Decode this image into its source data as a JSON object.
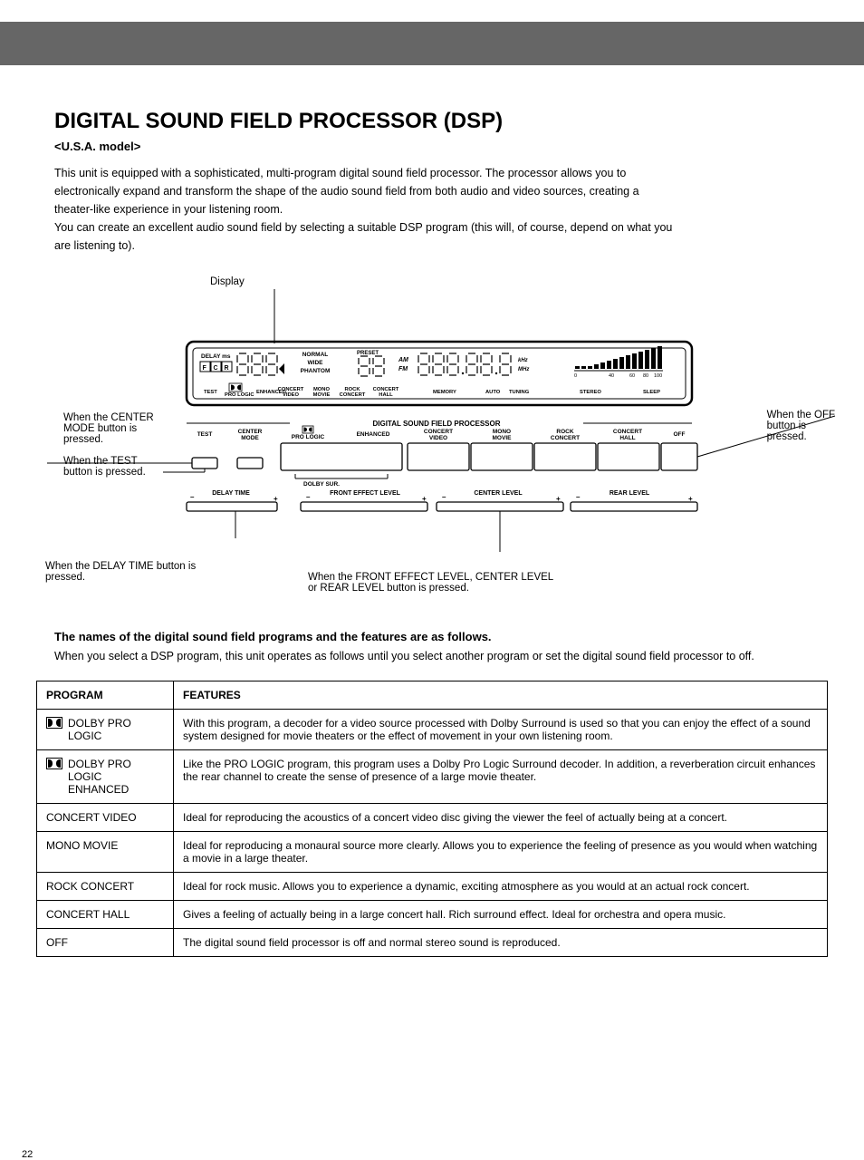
{
  "title": "DIGITAL SOUND FIELD PROCESSOR (DSP)",
  "subtitle": "<U.S.A. model>",
  "intro": [
    "This unit is equipped with a sophisticated, multi-program digital sound field processor. The processor allows you to",
    "electronically expand and transform the shape of the audio sound field from both audio and video sources, creating a",
    "theater-like experience in your listening room.",
    "You can create an excellent audio sound field by selecting a suitable DSP program (this will, of course, depend on what you",
    "are listening to)."
  ],
  "displayLabel": "Display",
  "callouts": {
    "testBtn": "When the TEST\nbutton is pressed.",
    "centerBtn": "When the CENTER\nMODE button is\npressed.",
    "offBtn": "When the OFF\nbutton is\npressed.",
    "delayBtn": "When the DELAY TIME button is\npressed.",
    "levelBtns": "When the FRONT EFFECT LEVEL, CENTER LEVEL\nor REAR LEVEL button is pressed."
  },
  "lcd": {
    "delayMs": "DELAY ms",
    "fcr": [
      "F",
      "C",
      "R"
    ],
    "centerModes": [
      "NORMAL",
      "WIDE",
      "PHANTOM"
    ],
    "row2": [
      "TEST",
      "PRO LOGIC",
      "ENHANCED",
      "CONCERT\nVIDEO",
      "MONO\nMOVIE",
      "ROCK\nCONCERT",
      "CONCERT\nHALL",
      "MEMORY",
      "AUTO",
      "TUNING",
      "STEREO",
      "SLEEP"
    ],
    "preset": "PRESET",
    "am": "AM",
    "fm": "FM",
    "khz": "kHz",
    "mhz": "MHz",
    "vuScale": [
      "0",
      "40",
      "60",
      "80",
      "100"
    ]
  },
  "buttonsHeader": "DIGITAL SOUND FIELD PROCESSOR",
  "btnRow1": [
    "TEST",
    "CENTER\nMODE",
    "PRO LOGIC\nENHANCED",
    "CONCERT\nVIDEO",
    "MONO\nMOVIE",
    "ROCK\nCONCERT",
    "CONCERT\nHALL",
    "OFF"
  ],
  "dolbySur": "DOLBY SUR.",
  "sliders": [
    "DELAY TIME",
    "FRONT EFFECT LEVEL",
    "CENTER LEVEL",
    "REAR LEVEL"
  ],
  "progHead": "The names of the digital sound field programs and the features are as follows.",
  "progIntro": "When you select a DSP program, this unit operates as follows until you select another program or set the digital sound\nfield processor to off.",
  "table": {
    "headers": [
      "PROGRAM",
      "FEATURES"
    ],
    "rows": [
      [
        "DOLBY PRO LOGIC",
        "With this program, a decoder for a video source processed with Dolby Surround is used so that you can enjoy the effect of a sound system designed for movie theaters or the effect of movement in your own listening room."
      ],
      [
        "DOLBY PRO LOGIC ENHANCED",
        "Like the PRO LOGIC program, this program uses a Dolby Pro Logic Surround decoder. In addition, a reverberation circuit enhances the rear channel to create the sense of presence of a large movie theater."
      ],
      [
        "CONCERT VIDEO",
        "Ideal for reproducing the acoustics of a concert video disc giving the viewer the feel of actually being at a concert."
      ],
      [
        "MONO MOVIE",
        "Ideal for reproducing a monaural source more clearly. Allows you to experience the feeling of presence as you would when watching a movie in a large theater."
      ],
      [
        "ROCK CONCERT",
        "Ideal for rock music. Allows you to experience a dynamic, exciting atmosphere as you would at an actual rock concert."
      ],
      [
        "CONCERT HALL",
        "Gives a feeling of actually being in a large concert hall. Rich surround effect. Ideal for orchestra and opera music."
      ],
      [
        "OFF",
        "The digital sound field processor is off and normal stereo sound is reproduced."
      ]
    ]
  },
  "pageNum": "22"
}
